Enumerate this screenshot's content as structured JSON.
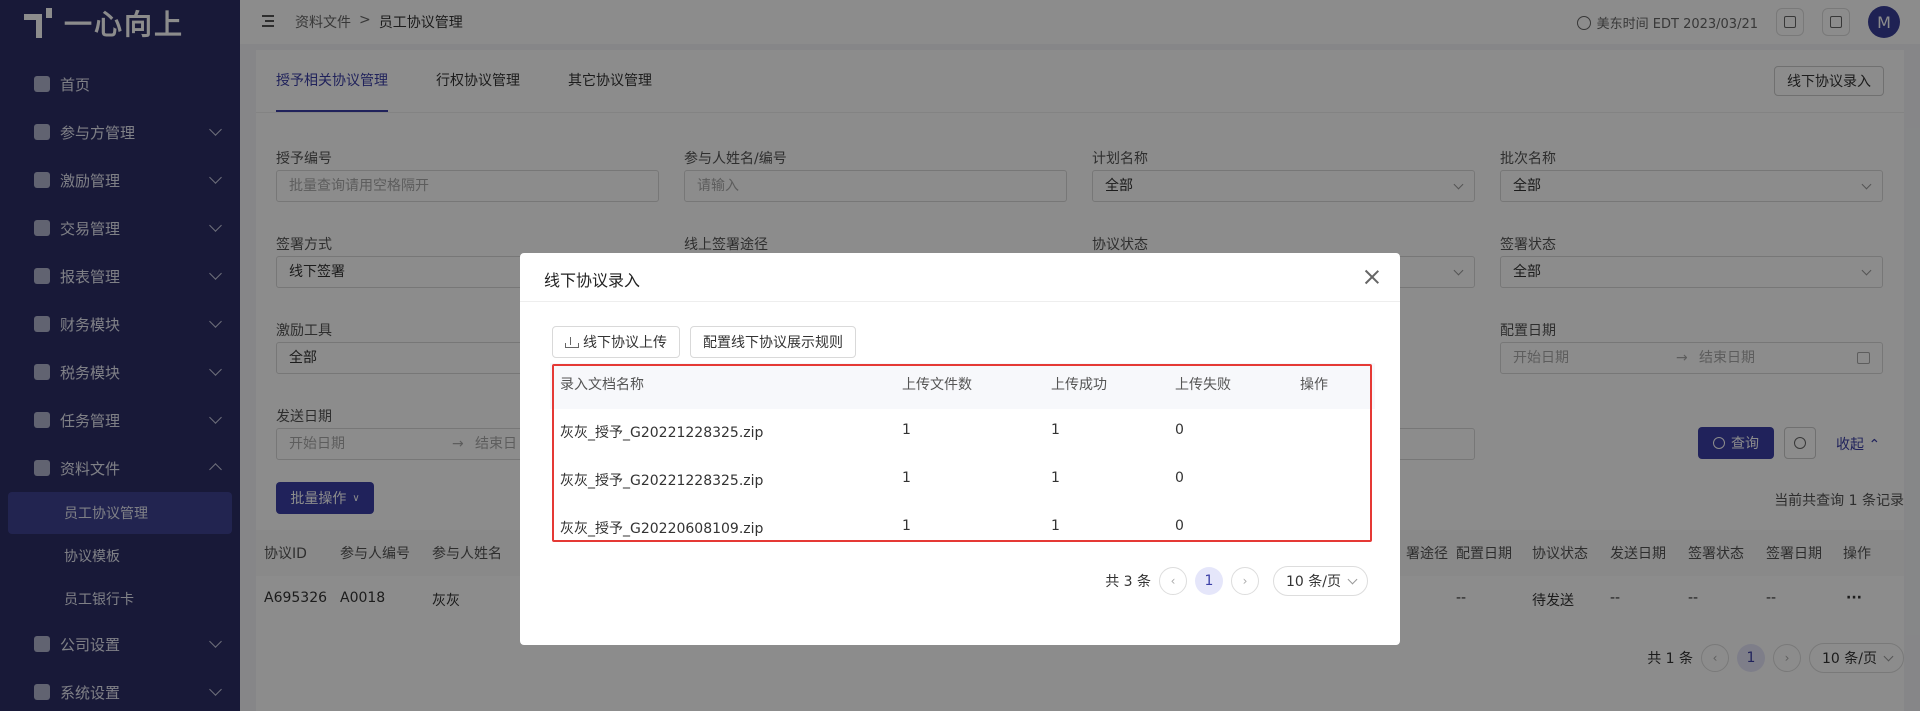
{
  "app": {
    "logo_text": "一心向上"
  },
  "header": {
    "breadcrumb": [
      "资料文件",
      ">",
      "员工协议管理"
    ],
    "time": "美东时间 EDT 2023/03/21",
    "avatar": "M"
  },
  "sidebar": {
    "items": [
      {
        "label": "首页",
        "icon": "home-icon"
      },
      {
        "label": "参与方管理",
        "icon": "users-icon"
      },
      {
        "label": "激励管理",
        "icon": "incentive-icon"
      },
      {
        "label": "交易管理",
        "icon": "trade-icon"
      },
      {
        "label": "报表管理",
        "icon": "report-icon"
      },
      {
        "label": "财务模块",
        "icon": "finance-icon"
      },
      {
        "label": "税务模块",
        "icon": "tax-icon"
      },
      {
        "label": "任务管理",
        "icon": "task-icon"
      },
      {
        "label": "资料文件",
        "icon": "folder-icon"
      }
    ],
    "sub_items": [
      "员工协议管理",
      "协议模板",
      "员工银行卡"
    ],
    "bottom_items": [
      {
        "label": "公司设置",
        "icon": "company-icon"
      },
      {
        "label": "系统设置",
        "icon": "settings-icon"
      }
    ]
  },
  "tabs": [
    "授予相关协议管理",
    "行权协议管理",
    "其它协议管理"
  ],
  "offline_entry_button": "线下协议录入",
  "filters": {
    "grant_no": {
      "label": "授予编号",
      "placeholder": "批量查询请用空格隔开"
    },
    "participant": {
      "label": "参与人姓名/编号",
      "placeholder": "请输入"
    },
    "plan_name": {
      "label": "计划名称",
      "value": "全部"
    },
    "batch_name": {
      "label": "批次名称",
      "value": "全部"
    },
    "sign_method": {
      "label": "签署方式",
      "value": "线下签署"
    },
    "online_route": {
      "label": "线上签署途径"
    },
    "agreement_status": {
      "label": "协议状态"
    },
    "sign_status": {
      "label": "签署状态",
      "value": "全部"
    },
    "incentive_tool": {
      "label": "激励工具",
      "value": "全部"
    },
    "config_date": {
      "label": "配置日期",
      "start": "开始日期",
      "end": "结束日期",
      "arrow": "→"
    },
    "send_date": {
      "label": "发送日期",
      "start": "开始日期",
      "end": "结束日"
    }
  },
  "actions": {
    "query": "查询",
    "collapse": "收起",
    "batch": "批量操作"
  },
  "main_table": {
    "summary": "当前共查询 1 条记录",
    "headers_left": [
      "协议ID",
      "参与人编号",
      "参与人姓名"
    ],
    "headers_right": [
      "署途径",
      "配置日期",
      "协议状态",
      "发送日期",
      "签署状态",
      "签署日期",
      "操作"
    ],
    "row": {
      "id": "A695326",
      "participant_no": "A0018",
      "name": "灰灰",
      "config_date": "--",
      "status": "待发送",
      "send_date": "--",
      "sign_status": "--",
      "sign_date": "--",
      "more": "···"
    },
    "pager": {
      "total": "共 1 条",
      "page": "1",
      "size": "10 条/页"
    }
  },
  "modal": {
    "title": "线下协议录入",
    "upload_button": "线下协议上传",
    "rule_button": "配置线下协议展示规则",
    "headers": [
      "录入文档名称",
      "上传文件数",
      "上传成功",
      "上传失败",
      "操作"
    ],
    "rows": [
      {
        "name": "灰灰_授予_G20221228325.zip",
        "files": "1",
        "success": "1",
        "fail": "0"
      },
      {
        "name": "灰灰_授予_G20221228325.zip",
        "files": "1",
        "success": "1",
        "fail": "0"
      },
      {
        "name": "灰灰_授予_G20220608109.zip",
        "files": "1",
        "success": "1",
        "fail": "0"
      }
    ],
    "pager": {
      "total": "共 3 条",
      "page": "1",
      "size": "10 条/页"
    }
  },
  "colors": {
    "sidebar": "#2c2e66",
    "accent": "#3b3fa6",
    "highlight": "#e53935"
  }
}
